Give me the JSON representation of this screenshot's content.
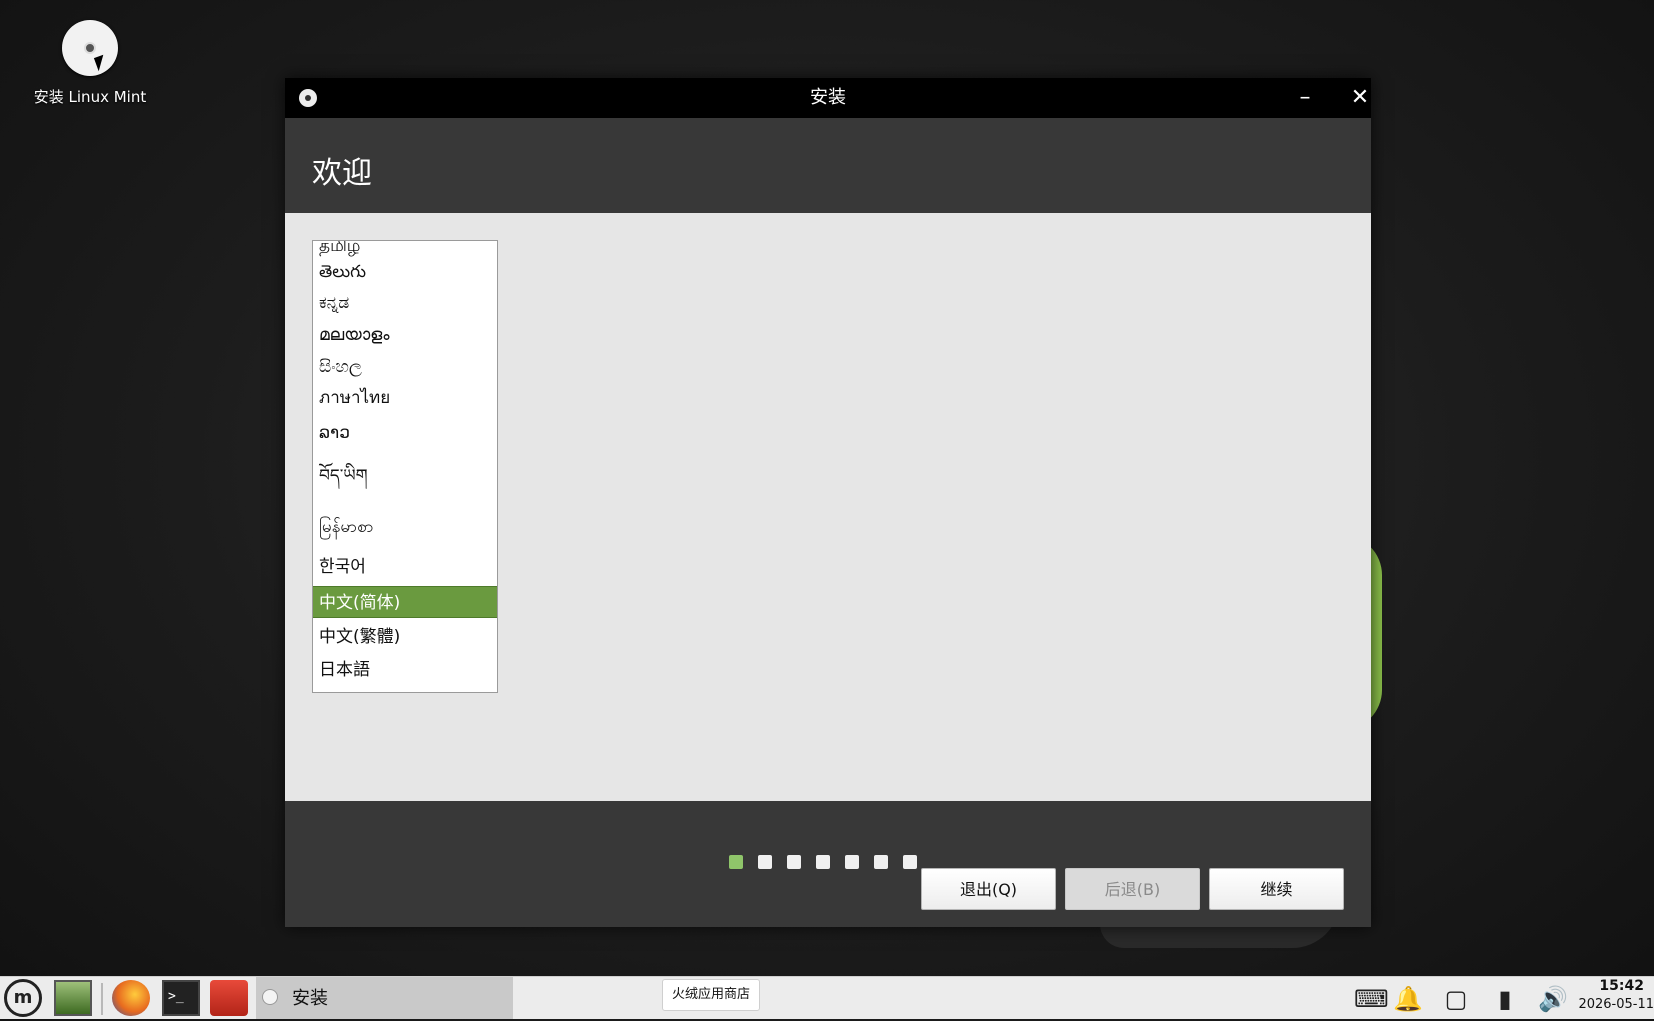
{
  "desktop": {
    "icon_label": "安装 Linux Mint"
  },
  "window": {
    "title": "安装",
    "minimize_glyph": "–",
    "close_glyph": "✕",
    "heading": "欢迎"
  },
  "languages": {
    "items": [
      {
        "label": "தமிழ்"
      },
      {
        "label": "తెలుగు"
      },
      {
        "label": "ಕನ್ನಡ"
      },
      {
        "label": "മലയാളം"
      },
      {
        "label": "සිංහල"
      },
      {
        "label": "ภาษาไทย"
      },
      {
        "label": "ລາວ"
      },
      {
        "label": "བོད་ཡིག"
      },
      {
        "label": "မြန်မာစာ"
      },
      {
        "label": "한국어"
      },
      {
        "label": "中文(简体)",
        "selected": true
      },
      {
        "label": "中文(繁體)"
      },
      {
        "label": "日本語"
      }
    ],
    "selected": "中文(简体)"
  },
  "buttons": {
    "quit": "退出(Q)",
    "back": "后退(B)",
    "continue": "继续"
  },
  "progress": {
    "total_steps": 7,
    "current_step": 1
  },
  "taskbar": {
    "active_window_label": "安装",
    "tooltip": "火绒应用商店",
    "clock_time": "15:42",
    "clock_date": "2026-05-11"
  },
  "colors": {
    "accent": "#6a9a3f",
    "active_dot": "#8fc56a",
    "titlebar": "#000000",
    "window_bg": "#383838",
    "content_bg": "#e6e6e6"
  }
}
